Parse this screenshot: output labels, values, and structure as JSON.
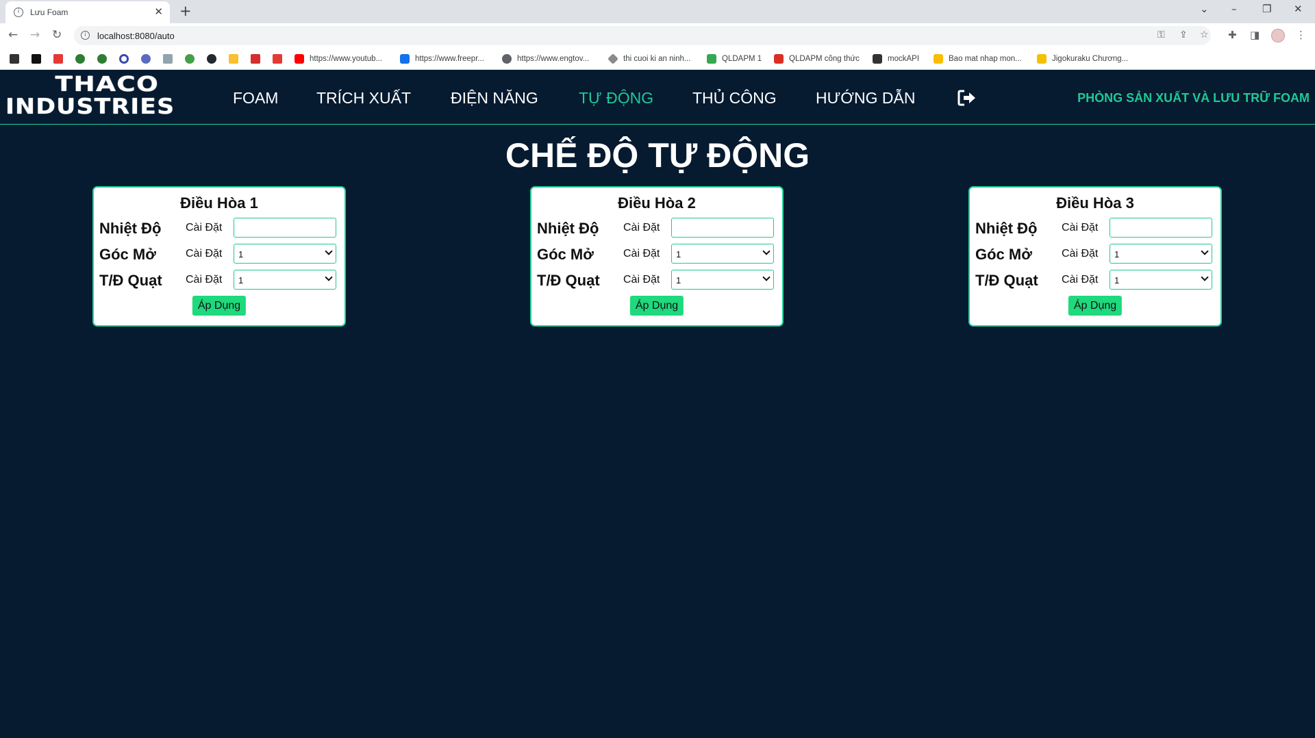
{
  "browser": {
    "tab_title": "Lưu Foam",
    "url": "localhost:8080/auto",
    "bookmarks": [
      {
        "label": "https://www.youtub...",
        "icon": "youtube-icon",
        "color": "#ff0000"
      },
      {
        "label": "https://www.freepr...",
        "icon": "freepik-icon",
        "color": "#1273eb"
      },
      {
        "label": "https://www.engtov...",
        "icon": "globe-icon",
        "color": "#5f6368"
      },
      {
        "label": "thi cuoi ki an ninh...",
        "icon": "diamond-icon",
        "color": "#8a8a8a"
      },
      {
        "label": "QLDAPM 1",
        "icon": "sheets-icon",
        "color": "#34a853"
      },
      {
        "label": "QLDAPM công thức",
        "icon": "list-icon",
        "color": "#d93025"
      },
      {
        "label": "mockAPI",
        "icon": "api-icon",
        "color": "#333333"
      },
      {
        "label": "Bao mat nhap mon...",
        "icon": "drive-icon",
        "color": "#fbbc04"
      },
      {
        "label": "Jigokuraku Chương...",
        "icon": "n-icon",
        "color": "#f2c200"
      }
    ]
  },
  "app": {
    "brand_line1": "THACO",
    "brand_line2": "INDUSTRIES",
    "nav": [
      {
        "label": "FOAM",
        "active": false
      },
      {
        "label": "TRÍCH XUẤT",
        "active": false
      },
      {
        "label": "ĐIỆN NĂNG",
        "active": false
      },
      {
        "label": "TỰ ĐỘNG",
        "active": true
      },
      {
        "label": "THỦ CÔNG",
        "active": false
      },
      {
        "label": "HƯỚNG DẪN",
        "active": false
      }
    ],
    "department": "PHÒNG SẢN XUẤT VÀ LƯU TRỮ FOAM",
    "page_title": "CHẾ ĐỘ TỰ ĐỘNG",
    "accent_color": "#20c997",
    "button_color": "#1fd97d",
    "panels": [
      {
        "title": "Điều Hòa 1",
        "rows": [
          {
            "label": "Nhiệt Độ",
            "sub": "Cài Đặt",
            "type": "input",
            "value": ""
          },
          {
            "label": "Góc Mở",
            "sub": "Cài Đặt",
            "type": "select",
            "value": "1"
          },
          {
            "label": "T/Đ Quạt",
            "sub": "Cài Đặt",
            "type": "select",
            "value": "1"
          }
        ],
        "apply_label": "Áp Dụng"
      },
      {
        "title": "Điều Hòa 2",
        "rows": [
          {
            "label": "Nhiệt Độ",
            "sub": "Cài Đặt",
            "type": "input",
            "value": ""
          },
          {
            "label": "Góc Mở",
            "sub": "Cài Đặt",
            "type": "select",
            "value": "1"
          },
          {
            "label": "T/Đ Quạt",
            "sub": "Cài Đặt",
            "type": "select",
            "value": "1"
          }
        ],
        "apply_label": "Áp Dụng"
      },
      {
        "title": "Điều Hòa 3",
        "rows": [
          {
            "label": "Nhiệt Độ",
            "sub": "Cài Đặt",
            "type": "input",
            "value": ""
          },
          {
            "label": "Góc Mở",
            "sub": "Cài Đặt",
            "type": "select",
            "value": "1"
          },
          {
            "label": "T/Đ Quạt",
            "sub": "Cài Đặt",
            "type": "select",
            "value": "1"
          }
        ],
        "apply_label": "Áp Dụng"
      }
    ]
  }
}
